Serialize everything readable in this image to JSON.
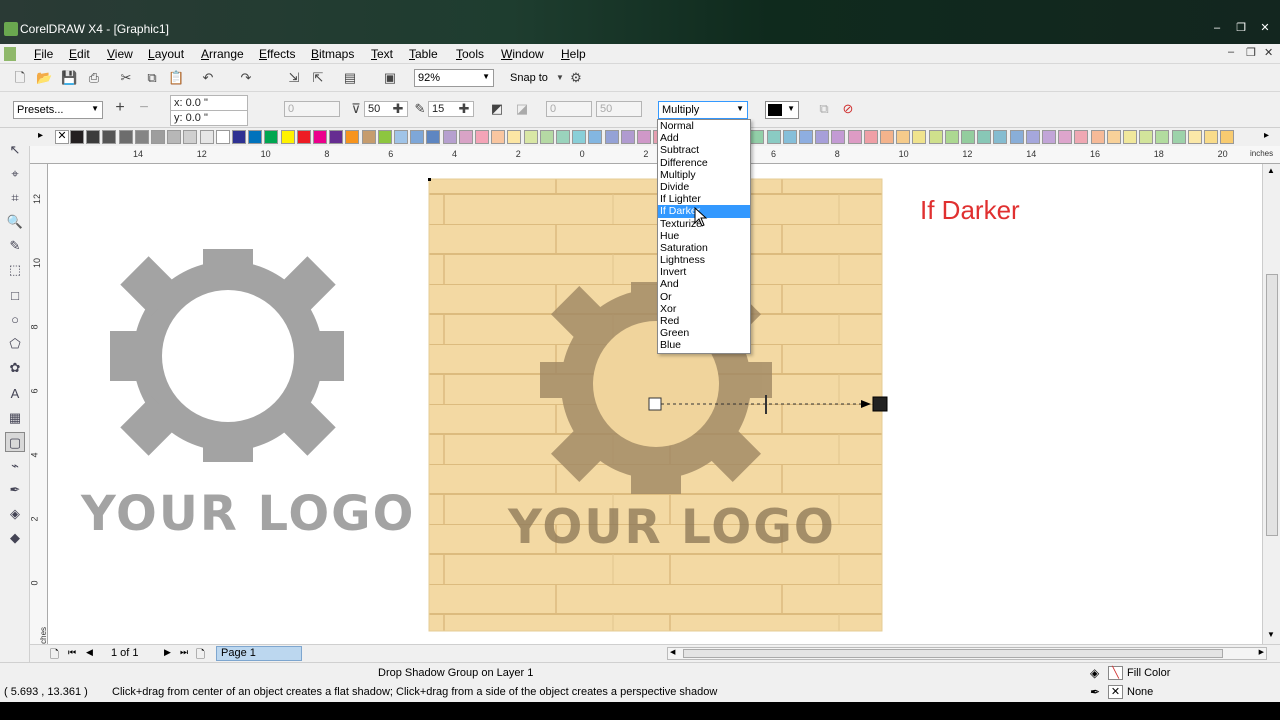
{
  "window": {
    "title": "CorelDRAW X4 - [Graphic1]",
    "controls": [
      "–",
      "❐",
      "✕"
    ]
  },
  "menubar": {
    "items": [
      "File",
      "Edit",
      "View",
      "Layout",
      "Arrange",
      "Effects",
      "Bitmaps",
      "Text",
      "Table",
      "Tools",
      "Window",
      "Help"
    ]
  },
  "toolbar": {
    "zoom": "92%",
    "snap_to": "Snap to"
  },
  "property_bar": {
    "presets": "Presets...",
    "x": "x: 0.0 \"",
    "y": "y: 0.0 \"",
    "shadow_offset": "0",
    "opacity": "50",
    "feather": "15",
    "fade": "0",
    "stretch": "50",
    "transparency_operation": "Multiply"
  },
  "blend_menu": {
    "items": [
      "Normal",
      "Add",
      "Subtract",
      "Difference",
      "Multiply",
      "Divide",
      "If Lighter",
      "If Darker",
      "Texturize",
      "Hue",
      "Saturation",
      "Lightness",
      "Invert",
      "And",
      "Or",
      "Xor",
      "Red",
      "Green",
      "Blue"
    ],
    "selected": "If Darker"
  },
  "rulers": {
    "top_ticks": [
      "14",
      "12",
      "10",
      "8",
      "6",
      "4",
      "2",
      "0",
      "2",
      "4",
      "6",
      "8",
      "10",
      "12",
      "14",
      "16",
      "18",
      "20",
      "22"
    ],
    "top_unit": "inches",
    "left_ticks": [
      "12",
      "10",
      "8",
      "6",
      "4",
      "2",
      "0"
    ],
    "left_unit": "inches"
  },
  "canvas": {
    "logo_left_text": "YOUR LOGO",
    "logo_shadow_text": "YOUR LOGO",
    "annotation": "If Darker"
  },
  "page_nav": {
    "counter": "1 of 1",
    "page_tab": "Page 1"
  },
  "status": {
    "object_info": "Drop Shadow Group on Layer 1",
    "coords": "( 5.693 , 13.361 )",
    "hint": "Click+drag from center of an object creates a flat shadow; Click+drag from a side of the object creates a perspective shadow",
    "fill": "Fill Color",
    "outline": "None"
  },
  "colors": {
    "wood_light": "#f3d9a3",
    "wood_line": "#dcbb7e",
    "logo_gray": "#a3a3a3",
    "shadow_brown": "#9f8763",
    "annotation_red": "#e03030",
    "selection_blue": "#3399ff"
  }
}
